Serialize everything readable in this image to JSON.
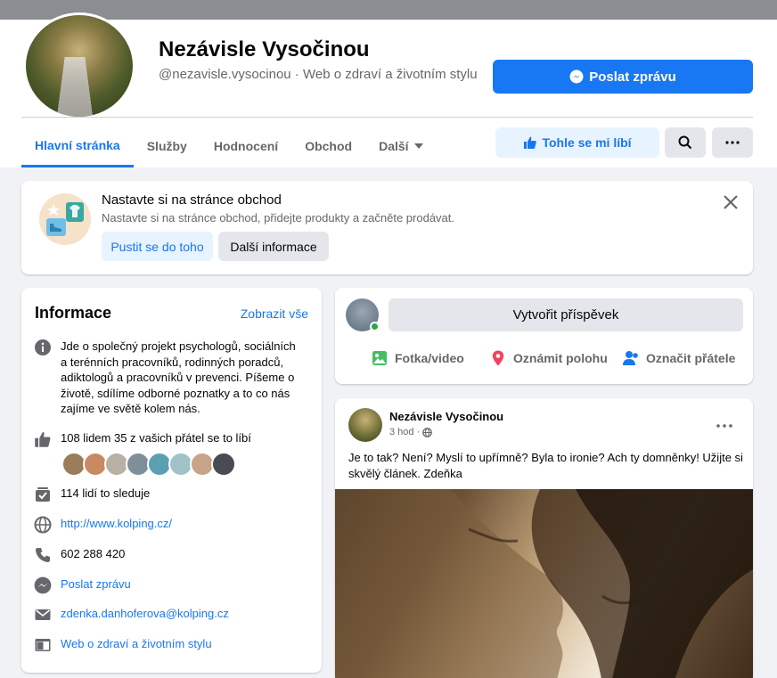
{
  "header": {
    "title": "Nezávisle Vysočinou",
    "handle": "@nezavisle.vysocinou · Web o zdraví a životním stylu",
    "send_message": "Poslat zprávu",
    "tabs": [
      {
        "label": "Hlavní stránka"
      },
      {
        "label": "Služby"
      },
      {
        "label": "Hodnocení"
      },
      {
        "label": "Obchod"
      },
      {
        "label": "Další"
      }
    ],
    "like_label": "Tohle se mi líbí"
  },
  "shop": {
    "title": "Nastavte si na stránce obchod",
    "subtitle": "Nastavte si na stránce obchod, přidejte produkty a začněte prodávat.",
    "start": "Pustit se do toho",
    "more": "Další informace"
  },
  "info": {
    "title": "Informace",
    "see_all": "Zobrazit vše",
    "about": "Jde o společný projekt psychologů, sociálních a terénních pracovníků, rodinných poradců, adiktologů a pracovníků v prevenci. Píšeme o životě, sdílíme odborné poznatky a to co nás zajíme ve světě kolem nás.",
    "likes": "108 lidem 35 z vašich přátel se to líbí",
    "followers": "114 lidí to sleduje",
    "website": "http://www.kolping.cz/",
    "phone": "602 288 420",
    "messenger": "Poslat zprávu",
    "email": "zdenka.danhoferova@kolping.cz",
    "category": "Web o zdraví a životním stylu"
  },
  "composer": {
    "create": "Vytvořit příspěvek",
    "photo": "Fotka/video",
    "location": "Oznámit polohu",
    "tag": "Označit přátele"
  },
  "post": {
    "author": "Nezávisle Vysočinou",
    "time": "3 hod ·",
    "text": "Je to tak? Není? Myslí to upřímně? Byla to ironie? Ach ty domněnky! Užijte si skvělý článek. Zdeňka"
  },
  "colors": {
    "accent": "#1877f2",
    "background": "#f0f2f5",
    "online": "#31a24c"
  }
}
